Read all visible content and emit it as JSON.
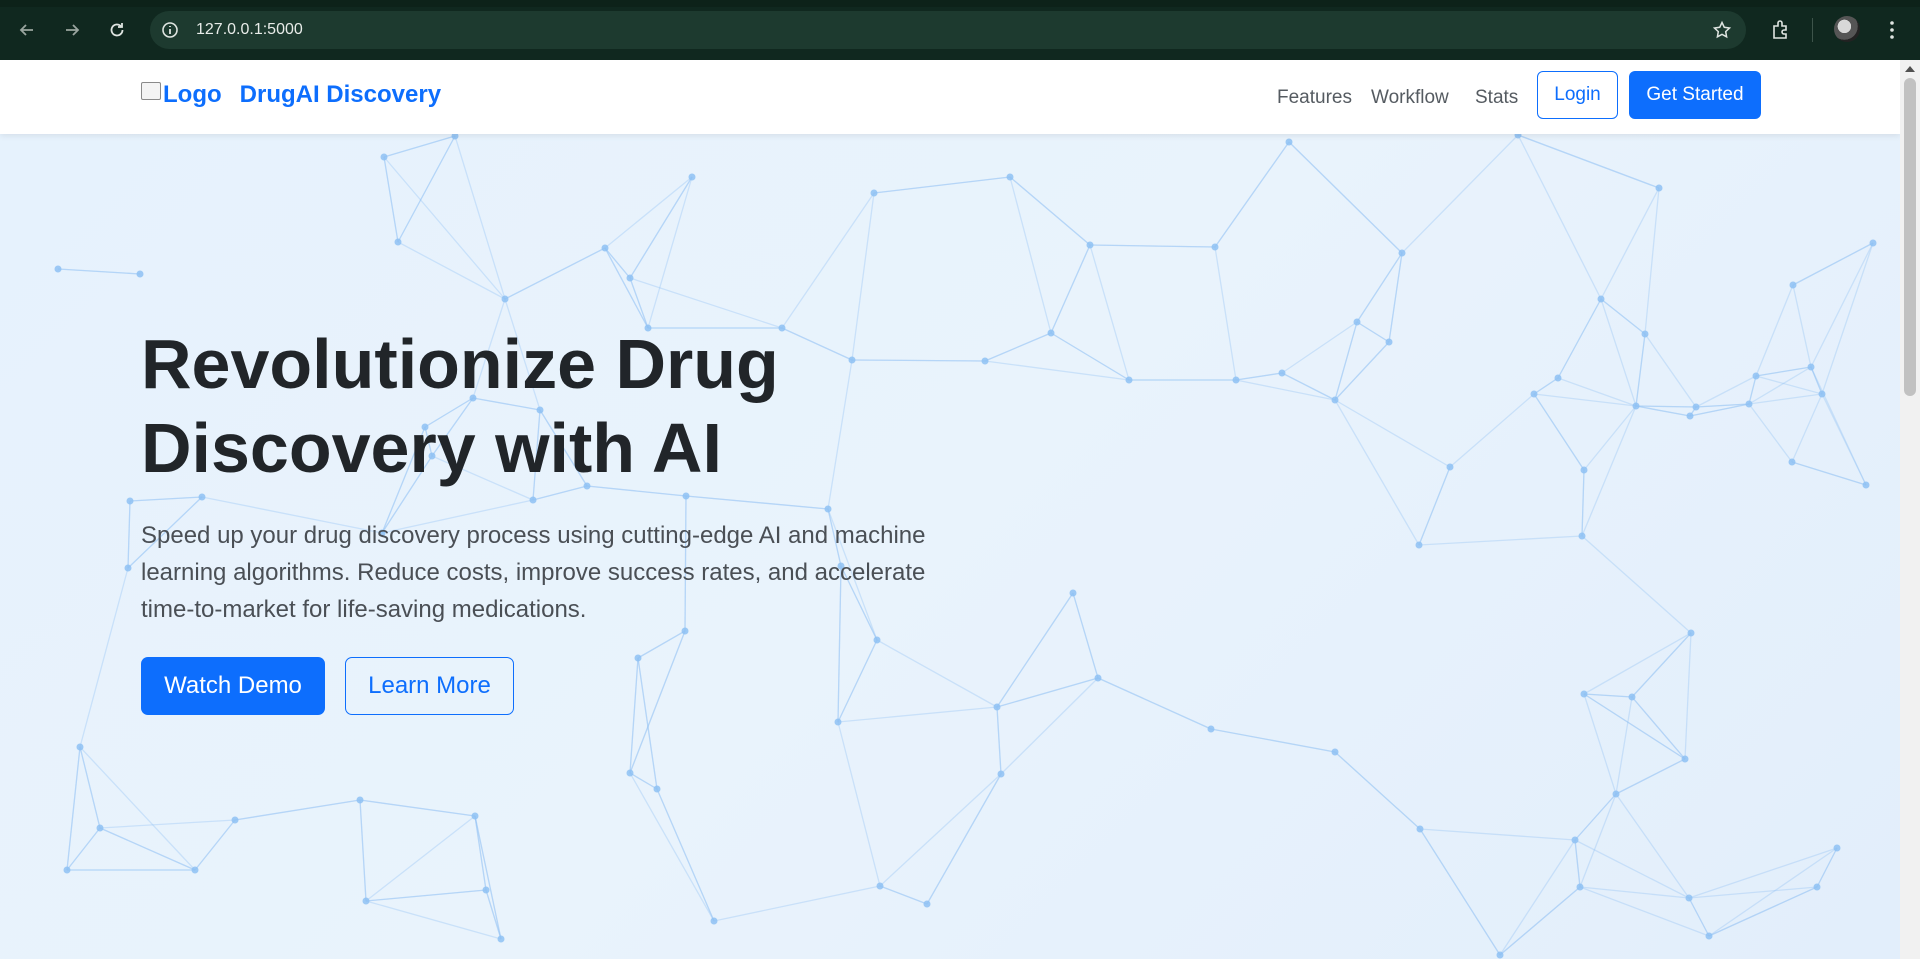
{
  "browser": {
    "url": "127.0.0.1:5000",
    "icons": [
      "back-arrow-icon",
      "forward-arrow-icon",
      "reload-icon",
      "site-info-icon",
      "bookmark-star-icon",
      "extensions-icon",
      "profile-avatar",
      "more-menu-icon"
    ]
  },
  "navbar": {
    "logo_alt": "Logo",
    "brand_name": "DrugAI Discovery",
    "links": [
      "Features",
      "Workflow",
      "Stats"
    ],
    "login_label": "Login",
    "get_started_label": "Get Started"
  },
  "hero": {
    "title": "Revolutionize Drug Discovery with AI",
    "description": "Speed up your drug discovery process using cutting-edge AI and machine learning algorithms. Reduce costs, improve success rates, and accelerate time-to-market for life-saving medications.",
    "watch_demo_label": "Watch Demo",
    "learn_more_label": "Learn More"
  },
  "colors": {
    "primary": "#0d6efd",
    "heading": "#212529",
    "hero_bg": "#e7f2fd",
    "network_node": "#8ec1f3",
    "browser_bg": "#10281f"
  }
}
